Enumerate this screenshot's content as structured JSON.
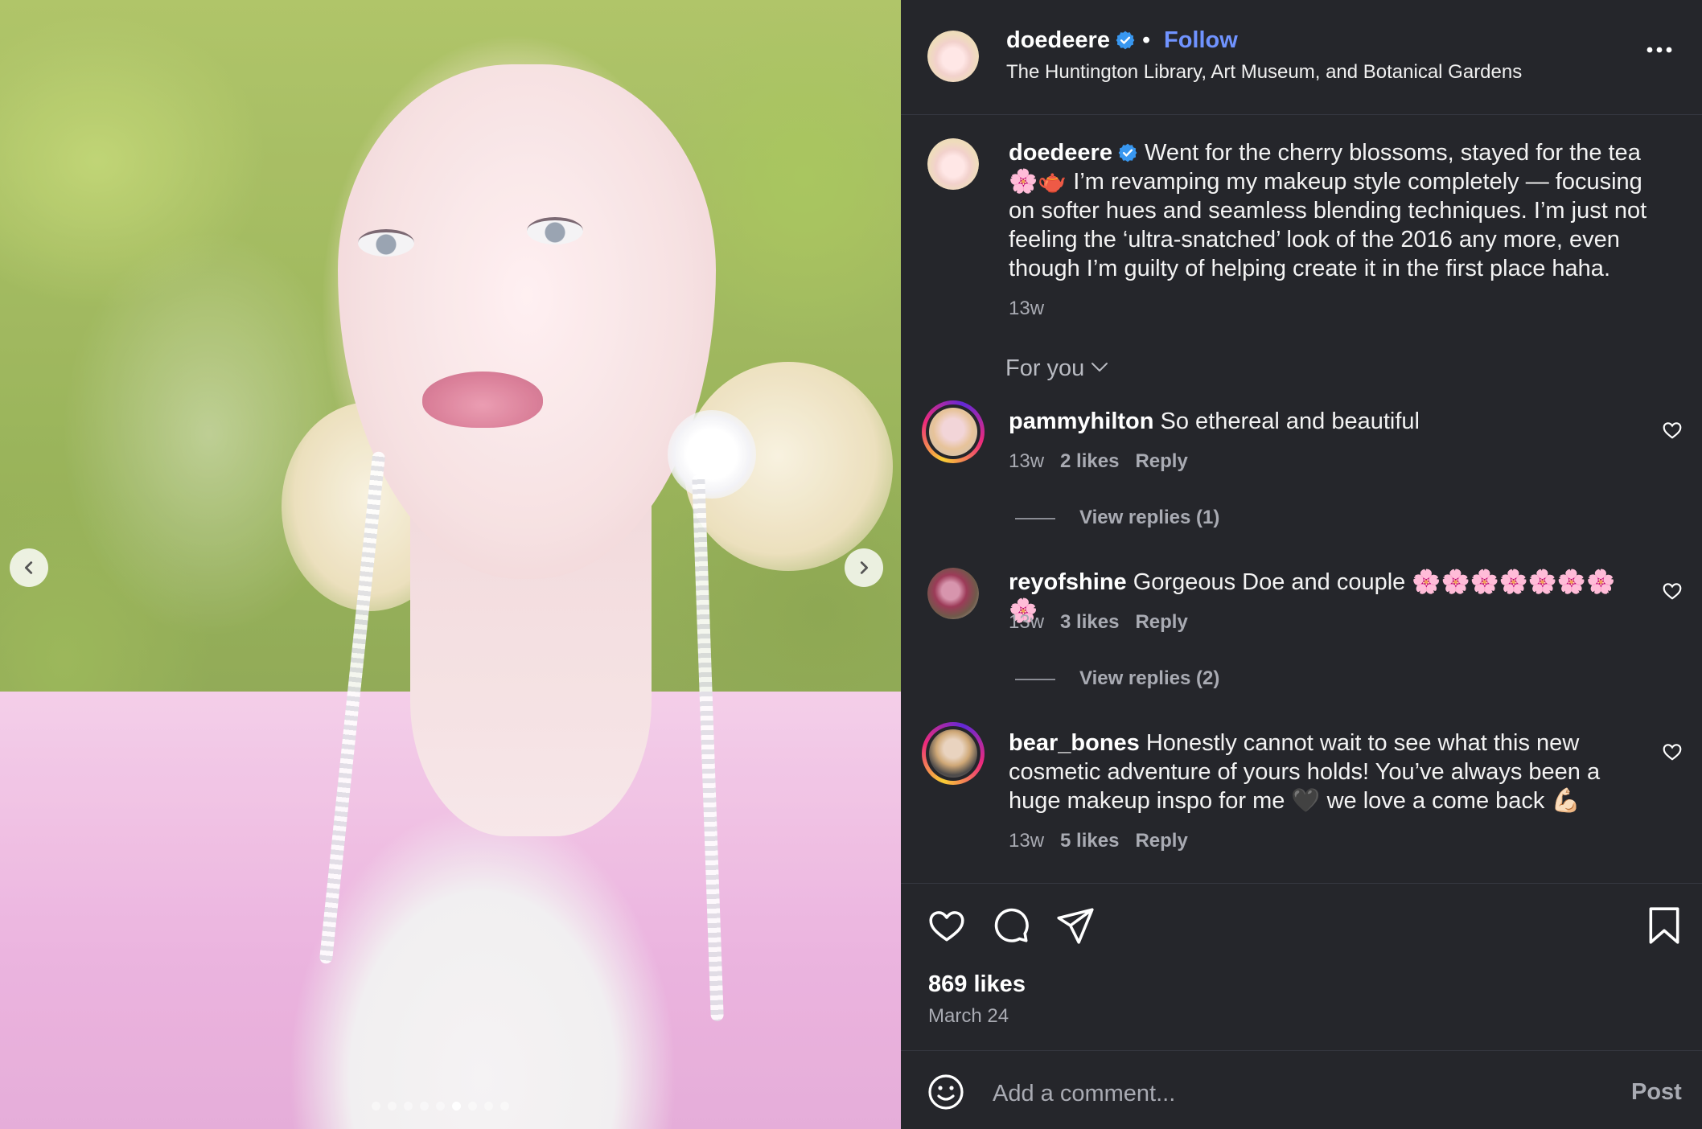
{
  "post": {
    "username": "doedeere",
    "follow_label": "Follow",
    "separator": "•",
    "location": "The Huntington Library, Art Museum, and Botanical Gardens"
  },
  "caption": {
    "username": "doedeere",
    "text": "Went for the cherry blossoms, stayed for the tea 🌸🫖 I’m revamping my makeup style completely — focusing on softer hues and seamless blending techniques. I’m just not feeling the ‘ultra-snatched’ look of the 2016 any more, even though I’m guilty of helping create it in the first place haha.",
    "time": "13w"
  },
  "comments_filter": {
    "label": "For you"
  },
  "comments": [
    {
      "username": "pammyhilton",
      "text": "So ethereal and beautiful",
      "time": "13w",
      "likes": "2 likes",
      "reply": "Reply",
      "view_replies": "View replies (1)"
    },
    {
      "username": "reyofshine",
      "text": "Gorgeous Doe and couple 🌸🌸🌸🌸🌸🌸🌸🌸",
      "time": "13w",
      "likes": "3 likes",
      "reply": "Reply",
      "view_replies": "View replies (2)"
    },
    {
      "username": "bear_bones",
      "text": "Honestly cannot wait to see what this new cosmetic adventure of yours holds! You’ve always been a huge makeup inspo for me 🖤 we love a come back 💪🏻",
      "time": "13w",
      "likes": "5 likes",
      "reply": "Reply"
    }
  ],
  "stats": {
    "likes": "869 likes",
    "date": "March 24"
  },
  "composer": {
    "placeholder": "Add a comment...",
    "post_label": "Post"
  },
  "carousel": {
    "total": 9,
    "active": 5
  },
  "colors": {
    "panel_bg": "#25262b",
    "link_blue": "#7093ff",
    "verified_blue": "#3897f0",
    "muted_text": "#a9abb3"
  },
  "icons": [
    "chevron-left-icon",
    "chevron-right-icon",
    "verified-badge-icon",
    "more-options-icon",
    "chevron-down-icon",
    "heart-icon",
    "comment-icon",
    "share-icon",
    "bookmark-icon",
    "emoji-icon"
  ]
}
